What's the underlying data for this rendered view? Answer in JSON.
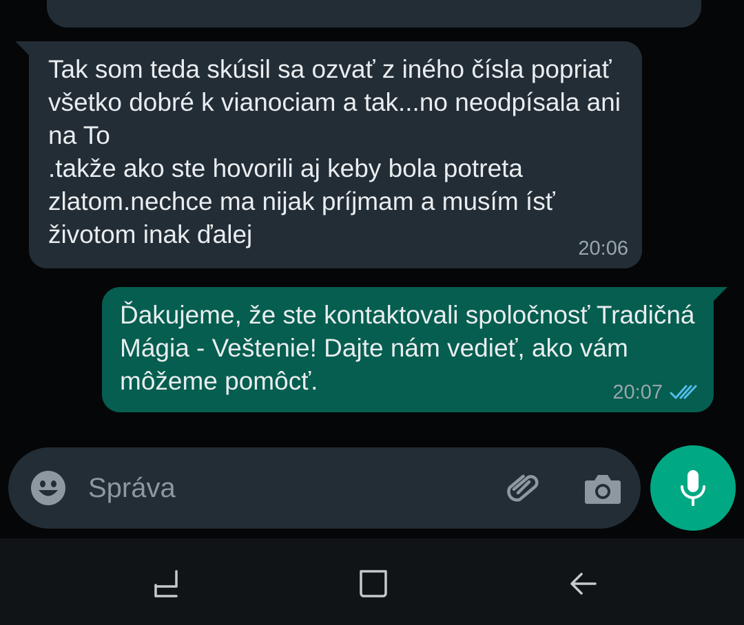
{
  "messages": [
    {
      "direction": "incoming",
      "text": "Tak som teda skúsil sa ozvať z iného čísla popriať všetko dobré k vianociam a tak...no neodpísala ani na To\n.takže ako ste hovorili aj keby bola potreta zlatom.nechce ma nijak príjmam a musím ísť životom inak ďalej",
      "time": "20:06"
    },
    {
      "direction": "outgoing",
      "text": "Ďakujeme, že ste kontaktovali spoločnosť Tradičná Mágia - Veštenie! Dajte nám vedieť, ako vám môžeme pomôcť.",
      "time": "20:07",
      "status": "read"
    }
  ],
  "composer": {
    "placeholder": "Správa",
    "icons": [
      "emoji-icon",
      "paperclip-icon",
      "camera-icon",
      "microphone-icon"
    ]
  },
  "navbar": {
    "icons": [
      "recent-apps-icon",
      "home-icon",
      "back-icon"
    ]
  },
  "colors": {
    "incoming_bubble": "#232d36",
    "outgoing_bubble": "#055e4f",
    "accent": "#00a884",
    "read_ticks": "#53bdeb"
  }
}
